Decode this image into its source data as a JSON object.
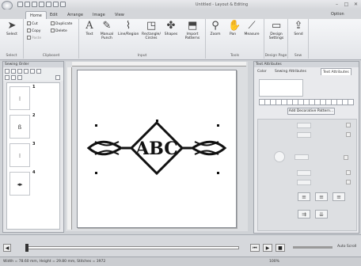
{
  "title": "Untitled - Layout & Editing",
  "tabs": [
    "Home",
    "Edit",
    "Arrange",
    "Image",
    "View"
  ],
  "option_label": "Option",
  "ribbon": {
    "groups": [
      "Select",
      "Clipboard",
      "Input",
      "Tools",
      "Design Page",
      "Sew"
    ],
    "select_label": "Select",
    "cut": "Cut",
    "copy": "Copy",
    "paste": "Paste",
    "duplicate": "Duplicate",
    "delete": "Delete",
    "text": "Text",
    "manual_punch": "Manual Punch",
    "line_region": "Line/Region",
    "rectangle_circles": "Rectangle/ Circles",
    "shapes": "Shapes",
    "import_patterns": "Import Patterns",
    "zoom": "Zoom",
    "pan": "Pan",
    "measure": "Measure",
    "design_settings": "Design Settings",
    "send": "Send"
  },
  "left_panel": {
    "title": "Sewing Order",
    "items": [
      {
        "num": "1",
        "glyph": "⁞"
      },
      {
        "num": "2",
        "glyph": "ß"
      },
      {
        "num": "3",
        "glyph": "⁞"
      },
      {
        "num": "4",
        "glyph": "◂▸"
      }
    ]
  },
  "design_text": "ABC",
  "right_panel": {
    "title": "Text Attributes",
    "tabs": [
      "Color",
      "Sewing Attributes",
      "Text Attributes"
    ],
    "pattern_button": "Add Decorative Pattern..."
  },
  "status": {
    "dimensions": "Width = 78.60 mm, Height = 29.80 mm, Stitches = 3972",
    "zoom": "100%",
    "auto_scroll": "Auto Scroll"
  }
}
